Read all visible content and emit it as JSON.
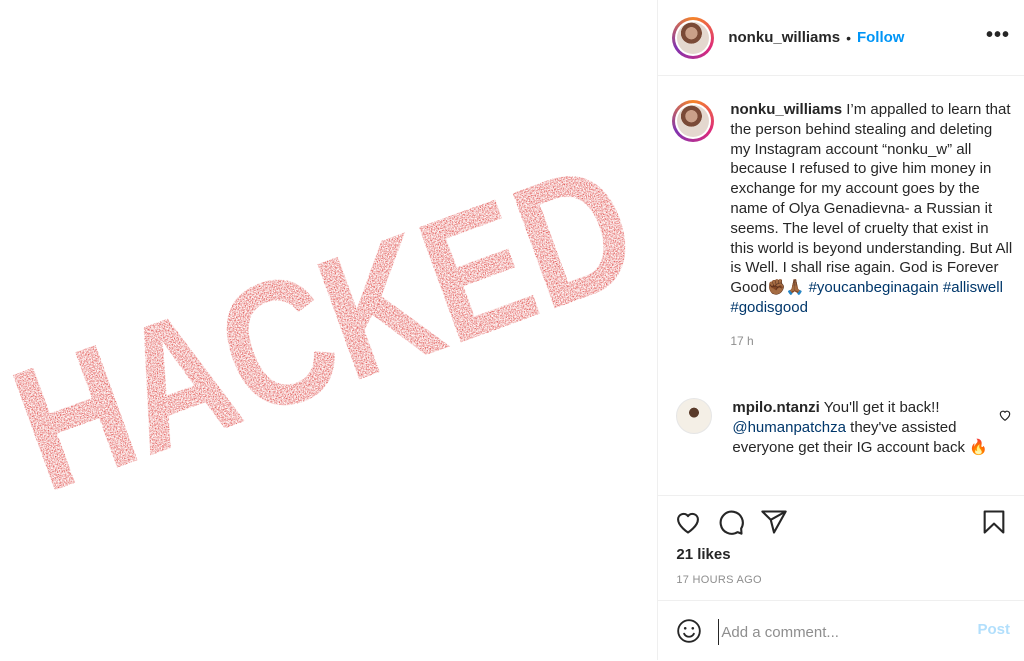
{
  "media": {
    "stamp_text": "HACKED",
    "stamp_color": "#d7201d"
  },
  "header": {
    "username": "nonku_williams",
    "separator": "•",
    "follow_label": "Follow",
    "more_icon": "more-horizontal-icon",
    "accent": "#0095f6"
  },
  "caption": {
    "username": "nonku_williams",
    "text": "I’m appalled to learn that the person behind stealing and deleting my Instagram account “nonku_w” all because I refused to give him money in exchange for my account goes by the name of Olya Genadievna- a Russian it seems. The level of cruelty that exist in this world is beyond understanding. But All is Well. I shall rise again. God is Forever Good✊🏾🙏🏾",
    "hashtags": [
      "#youcanbeginagain",
      "#alliswell",
      "#godisgood"
    ],
    "time": "17 h"
  },
  "comment": {
    "username": "mpilo.ntanzi",
    "text_before": "You'll get it back!!",
    "mention": "@humanpatchza",
    "text_after": "they've assisted everyone get their IG account back 🔥"
  },
  "actions": {
    "like_icon": "heart-icon",
    "comment_icon": "comment-icon",
    "share_icon": "share-icon",
    "save_icon": "bookmark-icon"
  },
  "likes": "21 likes",
  "posted_ago": "17 HOURS AGO",
  "comment_box": {
    "placeholder": "Add a comment...",
    "post_label": "Post",
    "post_color": "#b2dffc"
  }
}
